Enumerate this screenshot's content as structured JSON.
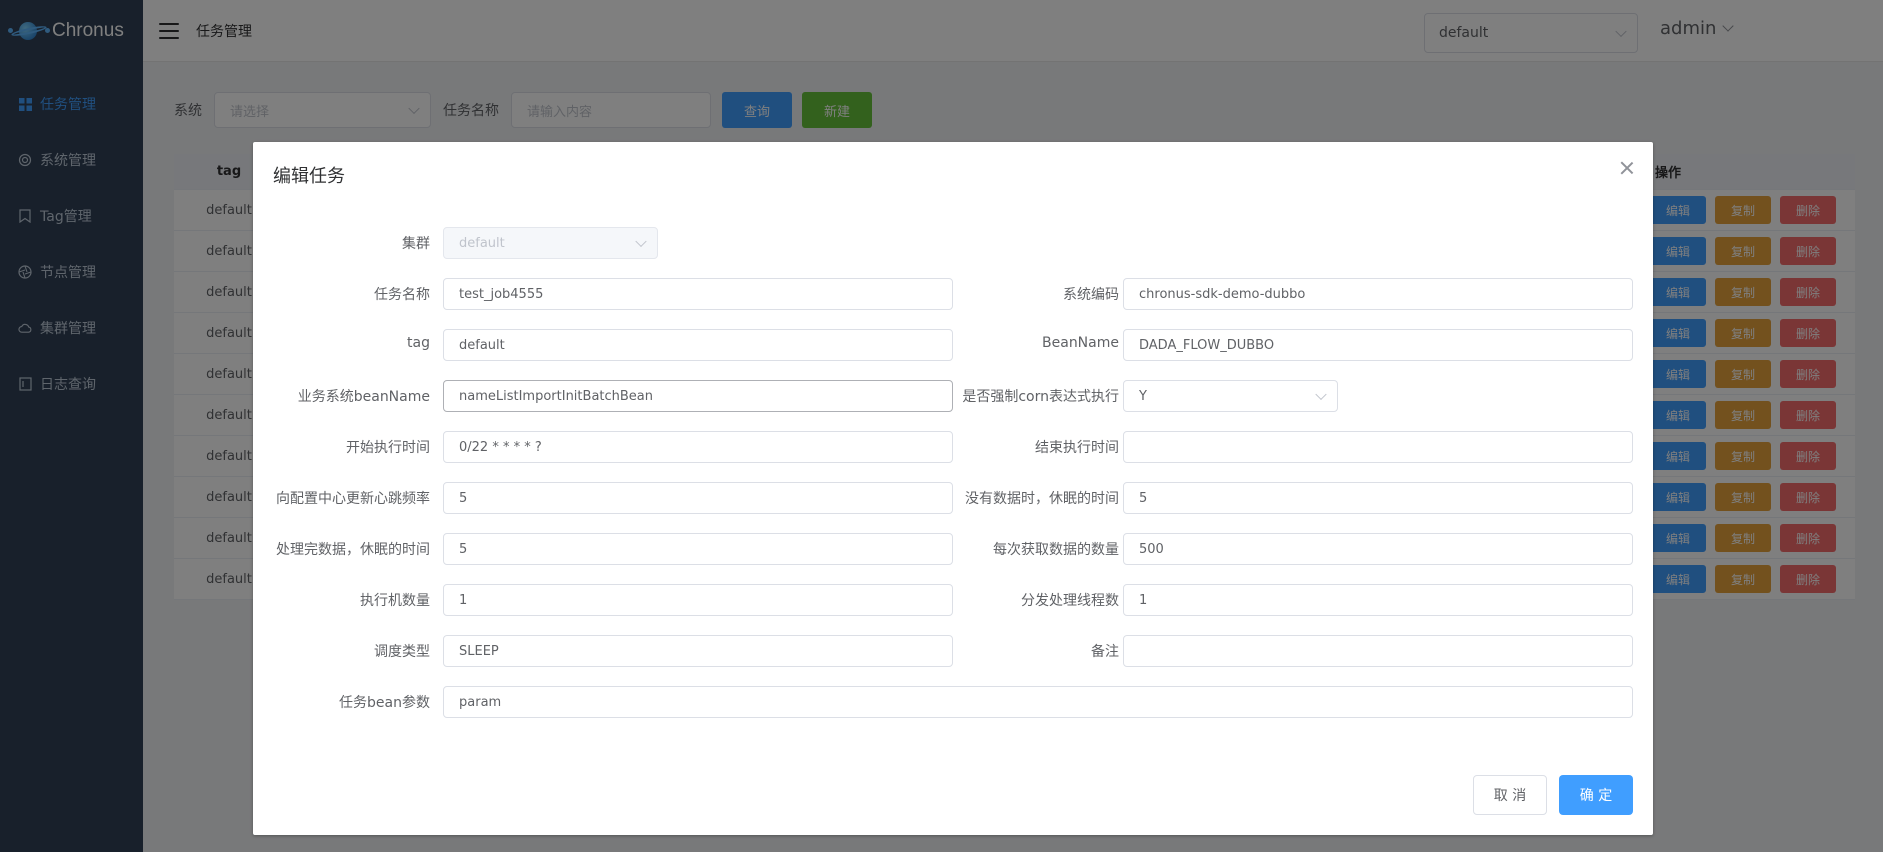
{
  "app": {
    "name": "Chronus"
  },
  "sidebar": {
    "items": [
      {
        "label": "任务管理",
        "icon": "grid-icon",
        "active": true
      },
      {
        "label": "系统管理",
        "icon": "chip-icon"
      },
      {
        "label": "Tag管理",
        "icon": "bookmark-icon"
      },
      {
        "label": "节点管理",
        "icon": "aperture-icon"
      },
      {
        "label": "集群管理",
        "icon": "cloud-icon"
      },
      {
        "label": "日志查询",
        "icon": "document-icon"
      }
    ]
  },
  "header": {
    "breadcrumb": "任务管理",
    "cluster_select": "default",
    "user": "admin"
  },
  "filter": {
    "system_label": "系统",
    "system_placeholder": "请选择",
    "task_name_label": "任务名称",
    "task_name_placeholder": "请输入内容",
    "query_label": "查询",
    "new_label": "新建"
  },
  "table": {
    "header_tag": "tag",
    "header_actions": "操作",
    "rows": [
      {
        "tag": "default"
      },
      {
        "tag": "default"
      },
      {
        "tag": "default"
      },
      {
        "tag": "default"
      },
      {
        "tag": "default"
      },
      {
        "tag": "default"
      },
      {
        "tag": "default"
      },
      {
        "tag": "default"
      },
      {
        "tag": "default"
      },
      {
        "tag": "default"
      }
    ],
    "edit_label": "编辑",
    "copy_label": "复制",
    "delete_label": "删除"
  },
  "dialog": {
    "title": "编辑任务",
    "cluster": {
      "label": "集群",
      "value": "default"
    },
    "task_name": {
      "label": "任务名称",
      "value": "test_job4555"
    },
    "system_code": {
      "label": "系统编码",
      "value": "chronus-sdk-demo-dubbo"
    },
    "tag": {
      "label": "tag",
      "value": "default"
    },
    "bean_name": {
      "label": "BeanName",
      "value": "DADA_FLOW_DUBBO"
    },
    "biz_bean_name": {
      "label": "业务系统beanName",
      "value": "nameListImportInitBatchBean"
    },
    "force_cron": {
      "label": "是否强制corn表达式执行",
      "value": "Y"
    },
    "start_time": {
      "label": "开始执行时间",
      "value": "0/22 * * * * ?"
    },
    "end_time": {
      "label": "结束执行时间",
      "value": ""
    },
    "heartbeat": {
      "label": "向配置中心更新心跳频率",
      "value": "5"
    },
    "no_data_sleep": {
      "label": "没有数据时，休眠的时间",
      "value": "5"
    },
    "done_sleep": {
      "label": "处理完数据，休眠的时间",
      "value": "5"
    },
    "fetch_count": {
      "label": "每次获取数据的数量",
      "value": "500"
    },
    "executor_count": {
      "label": "执行机数量",
      "value": "1"
    },
    "dispatch_threads": {
      "label": "分发处理线程数",
      "value": "1"
    },
    "schedule_type": {
      "label": "调度类型",
      "value": "SLEEP"
    },
    "remark": {
      "label": "备注",
      "value": ""
    },
    "bean_param": {
      "label": "任务bean参数",
      "value": "param"
    },
    "cancel_label": "取 消",
    "confirm_label": "确 定"
  },
  "colors": {
    "sidebar_bg": "#304156",
    "primary": "#409eff",
    "success": "#67c23a",
    "warning": "#e6a23c",
    "danger": "#f56c6c"
  }
}
